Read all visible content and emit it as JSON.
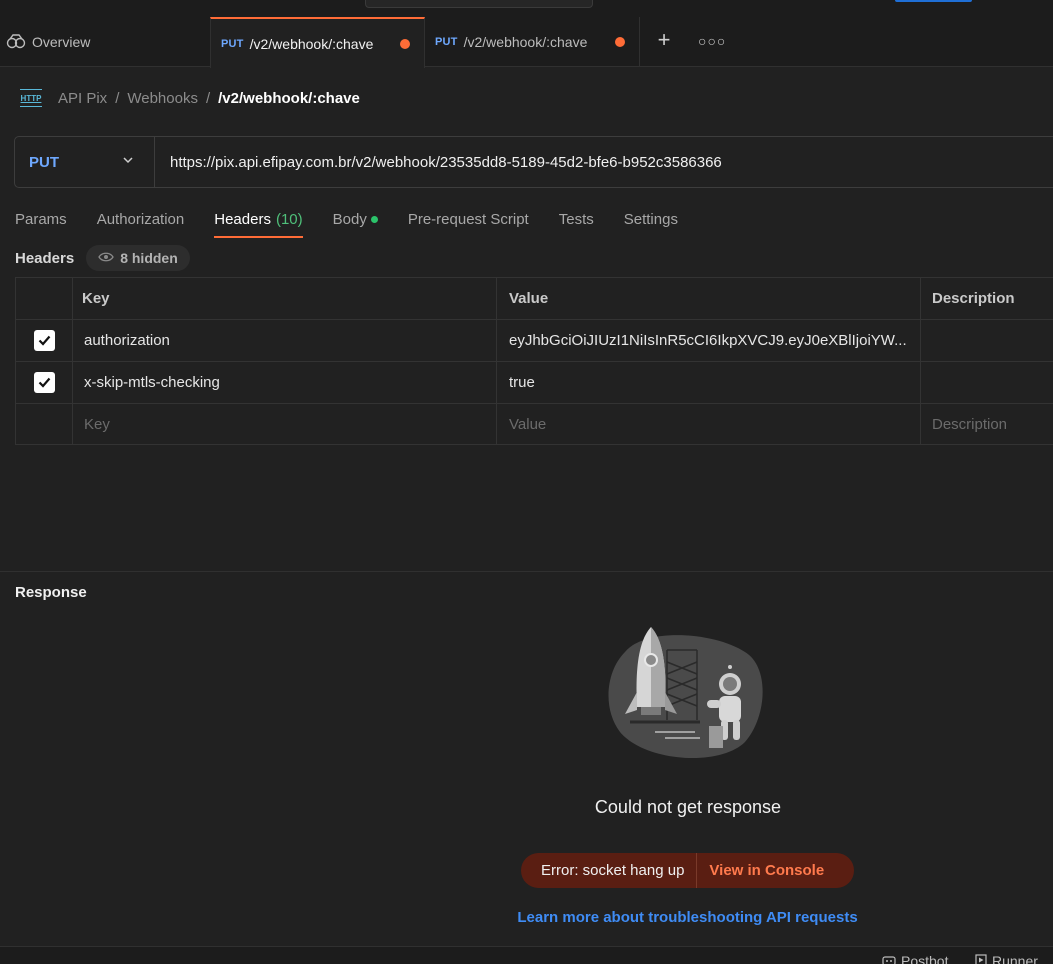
{
  "tabs": {
    "overview_label": "Overview",
    "items": [
      {
        "method": "PUT",
        "label": "/v2/webhook/:chave",
        "unsaved": true
      },
      {
        "method": "PUT",
        "label": "/v2/webhook/:chave",
        "unsaved": true
      }
    ]
  },
  "breadcrumb": {
    "icon_label": "HTTP",
    "items": [
      "API Pix",
      "Webhooks"
    ],
    "separator": "/",
    "current": "/v2/webhook/:chave"
  },
  "request": {
    "method": "PUT",
    "url": "https://pix.api.efipay.com.br/v2/webhook/23535dd8-5189-45d2-bfe6-b952c3586366"
  },
  "request_tabs": {
    "params": "Params",
    "authorization": "Authorization",
    "headers": "Headers",
    "headers_count": "(10)",
    "body": "Body",
    "prerequest": "Pre-request Script",
    "tests": "Tests",
    "settings": "Settings"
  },
  "headers_section": {
    "title": "Headers",
    "hidden_badge": "8 hidden",
    "columns": {
      "key": "Key",
      "value": "Value",
      "description": "Description"
    },
    "rows": [
      {
        "checked": true,
        "key": "authorization",
        "value": "eyJhbGciOiJIUzI1NiIsInR5cCI6IkpXVCJ9.eyJ0eXBlIjoiYW...",
        "description": ""
      },
      {
        "checked": true,
        "key": "x-skip-mtls-checking",
        "value": "true",
        "description": ""
      }
    ],
    "placeholders": {
      "key": "Key",
      "value": "Value",
      "description": "Description"
    }
  },
  "response": {
    "title": "Response",
    "message": "Could not get response",
    "error_text": "Error: socket hang up",
    "console_link": "View in Console",
    "learn_more": "Learn more about troubleshooting API requests"
  },
  "footer": {
    "postbot": "Postbot",
    "runner": "Runner"
  },
  "colors": {
    "accent": "#ff6c37",
    "method": "#6ea8fe",
    "link": "#3f8cf5",
    "success": "#2bc36a"
  }
}
